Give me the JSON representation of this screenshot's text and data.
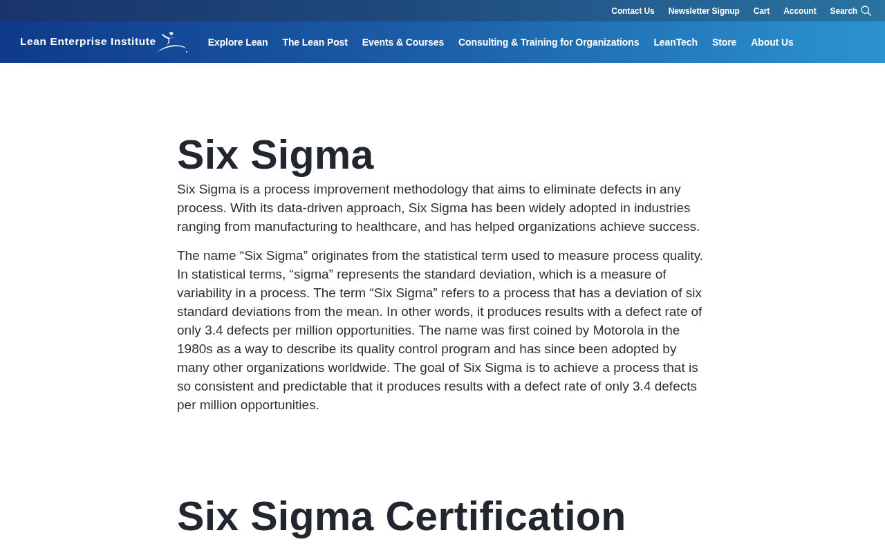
{
  "top_links": [
    "Contact Us",
    "Newsletter Signup",
    "Cart",
    "Account"
  ],
  "search": {
    "label": "Search"
  },
  "logo": {
    "text": "Lean Enterprise Institute"
  },
  "nav": [
    "Explore Lean",
    "The Lean Post",
    "Events & Courses",
    "Consulting & Training for Organizations",
    "LeanTech",
    "Store",
    "About Us"
  ],
  "sections": [
    {
      "heading": "Six Sigma",
      "paragraphs": [
        "Six Sigma is a process improvement methodology that aims to eliminate defects in any process. With its data-driven approach, Six Sigma has been widely adopted in industries ranging from manufacturing to healthcare, and has helped organizations achieve success.",
        "The name “Six Sigma” originates from the statistical term used to measure process quality. In statistical terms, “sigma” represents the standard deviation, which is a measure of variability in a process. The term “Six Sigma” refers to a process that has a deviation of six standard deviations from the mean. In other words, it produces results with a defect rate of only 3.4 defects per million opportunities. The name was first coined by Motorola in the 1980s as a way to describe its quality control program and has since been adopted by many other organizations worldwide. The goal of Six Sigma is to achieve a process that is so consistent and predictable that it produces results with a defect rate of only 3.4 defects per million opportunities."
      ]
    },
    {
      "heading": "Six Sigma Certification"
    }
  ]
}
